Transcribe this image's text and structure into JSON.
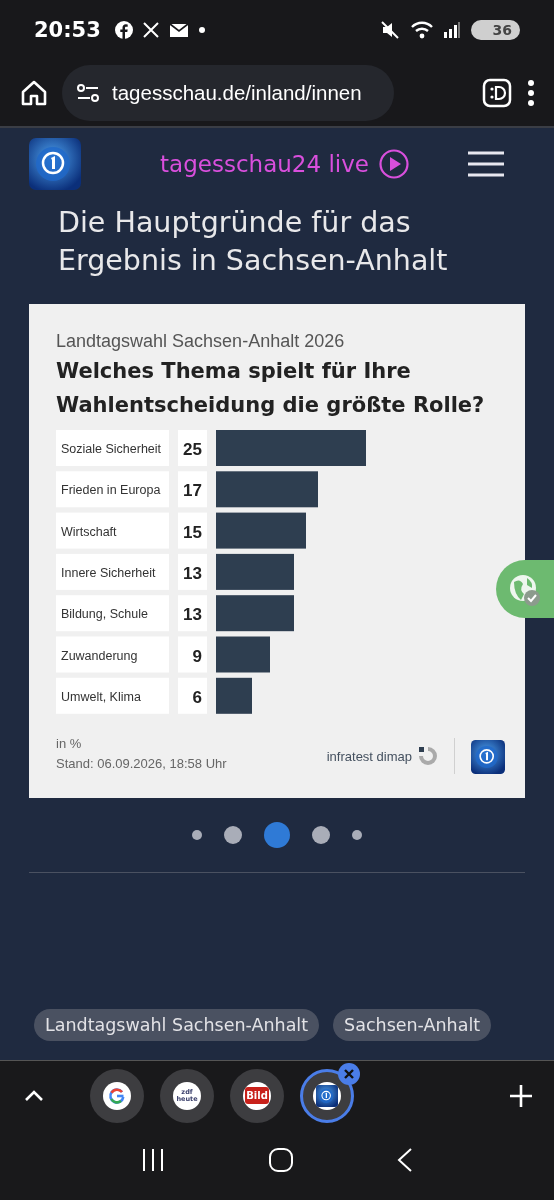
{
  "status_bar": {
    "time": "20:53",
    "battery": "36"
  },
  "browser": {
    "url": "tagesschau.de/inland/innen"
  },
  "site_header": {
    "live_label": "tagesschau24 live"
  },
  "article": {
    "title": "Die Hauptgründe für das Ergebnis in Sachsen-Anhalt"
  },
  "chart": {
    "subtitle": "Landtagswahl Sachsen-Anhalt 2026",
    "question": "Welches Thema spielt für Ihre Wahlentscheidung die größte Rolle?",
    "chart_data": {
      "type": "bar",
      "orientation": "horizontal",
      "categories": [
        "Soziale Sicherheit",
        "Frieden in Europa",
        "Wirtschaft",
        "Innere Sicherheit",
        "Bildung, Schule",
        "Zuwanderung",
        "Umwelt, Klima"
      ],
      "values": [
        25,
        17,
        15,
        13,
        13,
        9,
        6
      ],
      "data_labels": true
    },
    "unit_note": "in %",
    "date": "Stand:  06.09.2026, 18:58 Uhr",
    "source": "infratest dimap"
  },
  "carousel": {
    "dots": [
      {
        "selected": false
      },
      {
        "selected": false
      },
      {
        "selected": true
      },
      {
        "selected": false
      },
      {
        "selected": false
      }
    ]
  },
  "tags": [
    {
      "label": "Landtagswahl Sachsen-Anhalt"
    },
    {
      "label": "Sachsen-Anhalt"
    }
  ],
  "tabs": [
    {
      "kind": "google",
      "selected": false
    },
    {
      "kind": "zdf",
      "logo_text": "zdf heute",
      "selected": false
    },
    {
      "kind": "bild",
      "logo_text": "Bild",
      "selected": false
    },
    {
      "kind": "tagesschau",
      "selected": true
    }
  ]
}
